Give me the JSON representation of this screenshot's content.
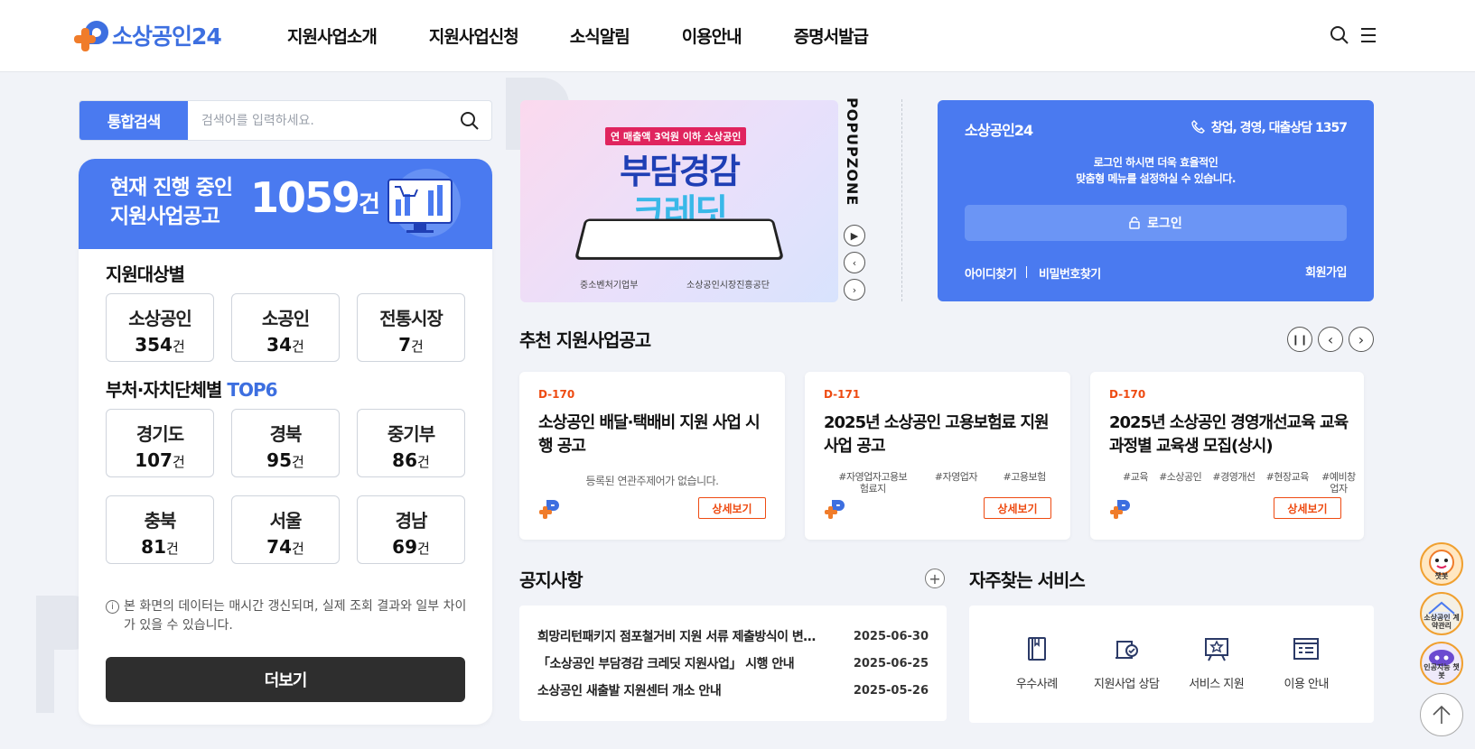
{
  "header": {
    "logo_text": "소상공인24",
    "nav": [
      "지원사업소개",
      "지원사업신청",
      "소식알림",
      "이용안내",
      "증명서발급"
    ]
  },
  "search": {
    "tab_label": "통합검색",
    "placeholder": "검색어를 입력하세요."
  },
  "ongoing": {
    "label": "현재 진행 중인 지원사업공고",
    "count": "1059",
    "unit": "건"
  },
  "by_target": {
    "title": "지원대상별",
    "items": [
      {
        "name": "소상공인",
        "count": "354"
      },
      {
        "name": "소공인",
        "count": "34"
      },
      {
        "name": "전통시장",
        "count": "7"
      }
    ]
  },
  "by_agency": {
    "title": "부처·자치단체별",
    "title_highlight": "TOP6",
    "items": [
      {
        "name": "경기도",
        "count": "107"
      },
      {
        "name": "경북",
        "count": "95"
      },
      {
        "name": "중기부",
        "count": "86"
      },
      {
        "name": "충북",
        "count": "81"
      },
      {
        "name": "서울",
        "count": "74"
      },
      {
        "name": "경남",
        "count": "69"
      }
    ]
  },
  "unit_label": "건",
  "info_notice": "본 화면의 데이터는 매시간 갱신되며, 실제 조회 결과와 일부 차이가 있을 수 있습니다.",
  "more_button": "더보기",
  "banner": {
    "badge": "연 매출액 3억원 이하 소상공인",
    "line1": "부담경감",
    "line2": "크레딧",
    "org1": "중소벤처기업부",
    "org2": "소상공인시장진흥공단"
  },
  "popupzone_label": "POPUPZONE",
  "login": {
    "site": "소상공인24",
    "tel": "창업, 경영, 대출상담 1357",
    "msg_line1": "로그인 하시면 더욱 효율적인",
    "msg_line2": "맞춤형 메뉴를 설정하실 수 있습니다.",
    "button": "로그인",
    "find_id": "아이디찾기",
    "find_pw": "비밀번호찾기",
    "join": "회원가입"
  },
  "recommended": {
    "title": "추천 지원사업공고",
    "detail_label": "상세보기",
    "no_related": "등록된 연관주제어가 없습니다.",
    "cards": [
      {
        "dday": "D-170",
        "title": "소상공인 배달·택배비 지원 사업 시행 공고",
        "tags": []
      },
      {
        "dday": "D-171",
        "title": "2025년 소상공인 고용보험료 지원사업 공고",
        "tags": [
          "#자영업자고용보험료지",
          "#자영업자",
          "#고용보험"
        ]
      },
      {
        "dday": "D-170",
        "title": "2025년 소상공인 경영개선교육 교육과정별 교육생 모집(상시)",
        "tags": [
          "#교육",
          "#소상공인",
          "#경영개선",
          "#현장교육",
          "#예비창업자"
        ]
      }
    ]
  },
  "notice": {
    "title": "공지사항",
    "rows": [
      {
        "title": "희망리턴패키지 점포철거비 지원 서류 제출방식이 변경 안내",
        "date": "2025-06-30"
      },
      {
        "title": "「소상공인 부담경감 크레딧 지원사업」 시행 안내",
        "date": "2025-06-25"
      },
      {
        "title": "소상공인 새출발 지원센터 개소 안내",
        "date": "2025-05-26"
      }
    ]
  },
  "services": {
    "title": "자주찾는 서비스",
    "items": [
      {
        "label": "우수사례",
        "icon": "book-icon"
      },
      {
        "label": "지원사업 상담",
        "icon": "consult-icon"
      },
      {
        "label": "서비스 지원",
        "icon": "award-board-icon"
      },
      {
        "label": "이용 안내",
        "icon": "guide-icon"
      }
    ]
  },
  "floating": {
    "chatbot": "챗봇",
    "contract": "소상공인 계약관리",
    "ai_chatbot": "인공지능 챗봇"
  },
  "colors": {
    "brand_blue": "#4a7af0",
    "brand_orange": "#f07c2a",
    "deadline_red": "#ee4b12"
  }
}
